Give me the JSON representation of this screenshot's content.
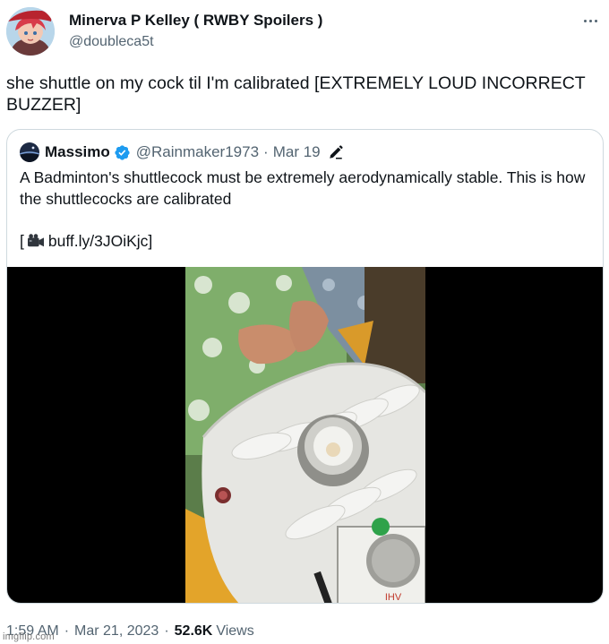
{
  "tweet": {
    "author": {
      "display_name": "Minerva P Kelley ( RWBY Spoilers )",
      "handle": "@doubleca5t"
    },
    "text": "she shuttle on my cock til I'm calibrated [EXTREMELY LOUD INCORRECT BUZZER]",
    "timestamp": "1:59 AM",
    "date": "Mar 21, 2023",
    "separator": "·",
    "views_count": "52.6K",
    "views_label": "Views"
  },
  "quote": {
    "author": {
      "display_name": "Massimo",
      "handle": "@Rainmaker1973",
      "verified": true
    },
    "separator": "·",
    "date": "Mar 19",
    "text": "A Badminton's shuttlecock must be extremely aerodynamically stable. This is how the shuttlecocks are calibrated",
    "link_open": "[",
    "link_text": "buff.ly/3JOiKjc",
    "link_close": "]",
    "media": {
      "type": "video",
      "subject": "shuttlecock calibration machine",
      "caption_text": "IHV"
    }
  },
  "watermark": "imgflip.com",
  "icons": {
    "more": "more-horizontal-icon",
    "verified": "verified-badge-icon",
    "edit": "pencil-icon",
    "camera": "video-camera-icon"
  },
  "colors": {
    "primary_text": "#0f1419",
    "secondary_text": "#536471",
    "border": "#cfd9de",
    "verified_blue": "#1d9bf0",
    "video_background": "#000000"
  }
}
